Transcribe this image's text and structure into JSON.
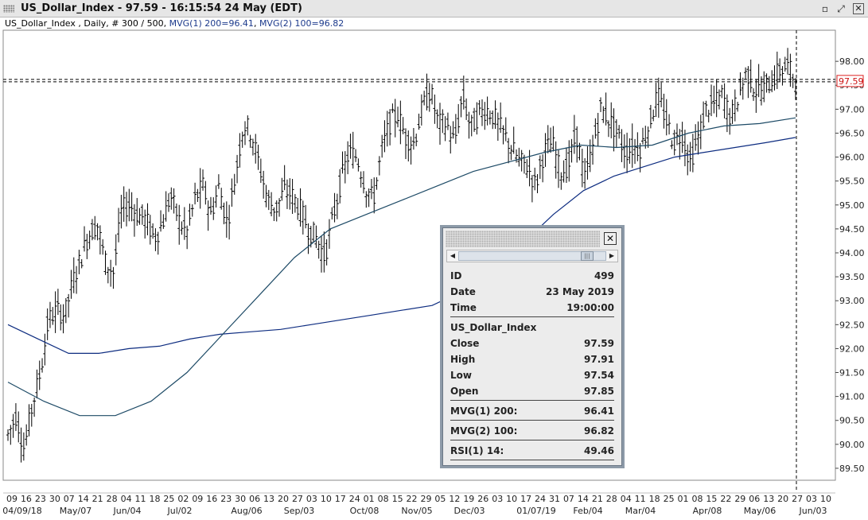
{
  "window": {
    "title": "US_Dollar_Index - 97.59 - 16:15:54  24 May (EDT)",
    "header_symbol": "US_Dollar_Index , Daily, # 300 / 500, ",
    "header_mvg1": "MVG(1) 200=96.41",
    "header_mvg1_sep": ", ",
    "header_mvg2": "MVG(2) 100=96.82"
  },
  "price_label": "97.59",
  "chart_data": {
    "type": "bar",
    "title": "",
    "ylim": [
      89.25,
      98.65
    ],
    "y_ticks": [
      "98.00",
      "97.50",
      "97.00",
      "96.50",
      "96.00",
      "95.50",
      "95.00",
      "94.50",
      "94.00",
      "93.50",
      "93.00",
      "92.50",
      "92.00",
      "91.50",
      "91.00",
      "90.50",
      "90.00",
      "89.50"
    ],
    "x_day_ticks": [
      "09",
      "16",
      "23",
      "30",
      "07",
      "14",
      "21",
      "28",
      "04",
      "11",
      "18",
      "25",
      "02",
      "09",
      "16",
      "23",
      "30",
      "06",
      "13",
      "20",
      "27",
      "03",
      "10",
      "17",
      "24",
      "01",
      "08",
      "15",
      "22",
      "29",
      "05",
      "12",
      "19",
      "26",
      "03",
      "10",
      "17",
      "24",
      "31",
      "07",
      "14",
      "21",
      "28",
      "04",
      "11",
      "18",
      "25",
      "01",
      "08",
      "15",
      "22",
      "29",
      "06",
      "13",
      "20",
      "27",
      "03",
      "10"
    ],
    "x_month_labels": [
      "04/09/18",
      "May/07",
      "Jun/04",
      "Jul/02",
      "Aug/06",
      "Sep/03",
      "Oct/08",
      "Nov/05",
      "Dec/03",
      "01/07/19",
      "Feb/04",
      "Mar/04",
      "Apr/08",
      "May/06",
      "Jun/03"
    ],
    "ohlc_path": [
      90.2,
      90.6,
      89.9,
      90.8,
      91.5,
      92.6,
      92.8,
      92.7,
      93.4,
      93.9,
      94.4,
      94.6,
      93.8,
      93.6,
      94.9,
      95.0,
      94.8,
      94.7,
      94.3,
      94.6,
      95.2,
      94.7,
      94.4,
      95.1,
      95.4,
      94.8,
      95.4,
      94.6,
      95.6,
      96.7,
      96.5,
      95.8,
      95.1,
      94.9,
      95.3,
      95.2,
      94.9,
      94.5,
      94.3,
      93.9,
      94.7,
      95.5,
      96.1,
      96.0,
      95.4,
      95.1,
      96.1,
      96.7,
      96.9,
      96.4,
      96.3,
      97.0,
      97.4,
      96.7,
      96.7,
      96.3,
      97.3,
      96.6,
      96.9,
      97.0,
      96.8,
      96.5,
      96.2,
      95.9,
      95.8,
      95.4,
      96.1,
      96.3,
      95.7,
      95.8,
      96.5,
      95.5,
      96.2,
      97.0,
      96.8,
      96.5,
      96.1,
      96.2,
      96.2,
      96.7,
      97.3,
      96.8,
      96.3,
      96.5,
      95.9,
      96.4,
      97.0,
      97.1,
      97.3,
      96.8,
      97.3,
      97.8,
      97.4,
      97.4,
      97.6,
      97.8,
      97.9,
      97.59
    ],
    "series": [
      {
        "name": "MVG(1) 200",
        "color": "#0d2c80",
        "values": [
          92.5,
          92.2,
          91.9,
          91.9,
          92.0,
          92.05,
          92.2,
          92.3,
          92.35,
          92.4,
          92.5,
          92.6,
          92.7,
          92.8,
          92.9,
          93.2,
          93.7,
          94.2,
          94.8,
          95.3,
          95.6,
          95.8,
          96.0,
          96.1,
          96.2,
          96.3,
          96.41
        ]
      },
      {
        "name": "MVG(2) 100",
        "color": "#1d4a66",
        "values": [
          91.3,
          90.9,
          90.6,
          90.6,
          90.9,
          91.5,
          92.3,
          93.1,
          93.9,
          94.5,
          94.8,
          95.1,
          95.4,
          95.7,
          95.9,
          96.1,
          96.25,
          96.2,
          96.25,
          96.5,
          96.65,
          96.7,
          96.82
        ]
      }
    ]
  },
  "popup": {
    "rows_top": [
      {
        "k": "ID",
        "v": "499"
      },
      {
        "k": "Date",
        "v": "23 May 2019"
      },
      {
        "k": "Time",
        "v": "19:00:00"
      }
    ],
    "symbol": "US_Dollar_Index",
    "rows_ohlc": [
      {
        "k": "Close",
        "v": "97.59"
      },
      {
        "k": "High",
        "v": "97.91"
      },
      {
        "k": "Low",
        "v": "97.54"
      },
      {
        "k": "Open",
        "v": "97.85"
      }
    ],
    "mvg1": {
      "k": "MVG(1) 200:",
      "v": "96.41"
    },
    "mvg2": {
      "k": "MVG(2) 100:",
      "v": "96.82"
    },
    "rsi": {
      "k": "RSI(1) 14:",
      "v": "49.46"
    },
    "close_glyph": "✕",
    "scroll_left": "◀",
    "scroll_right": "▶",
    "thumb_glyph": "|||"
  },
  "window_buttons": {
    "restore": "▫",
    "maximize": "⤢",
    "close": "✕"
  }
}
